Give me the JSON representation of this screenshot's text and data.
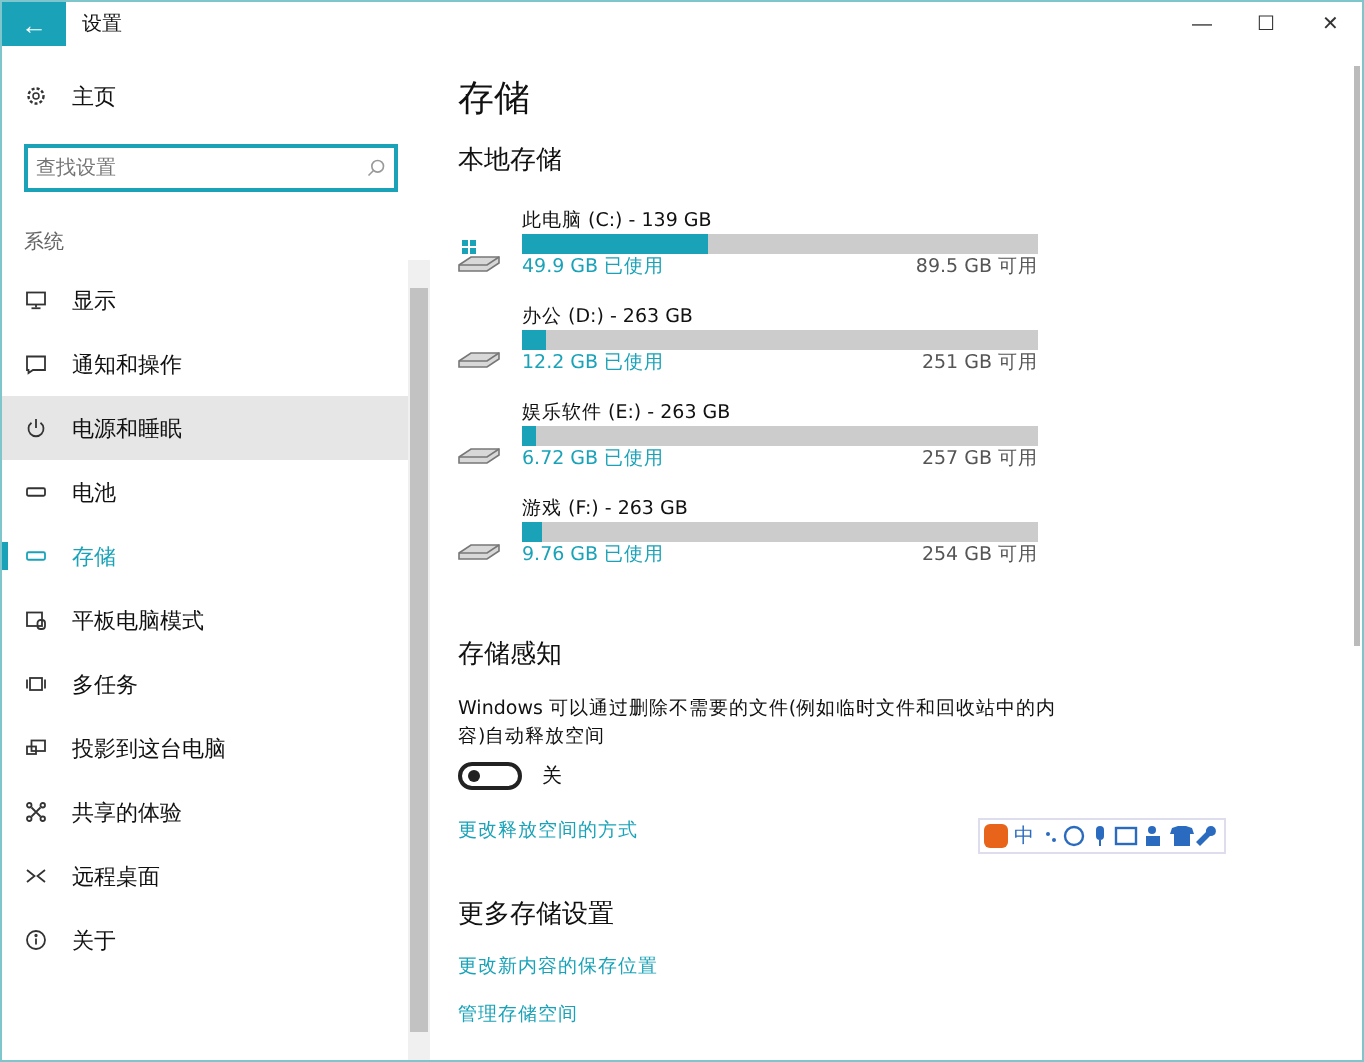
{
  "window": {
    "title": "设置",
    "back": "←",
    "controls": [
      "—",
      "☐",
      "✕"
    ]
  },
  "sidebar": {
    "home": "主页",
    "search": {
      "placeholder": "查找设置"
    },
    "section": "系统",
    "items": [
      {
        "label": "显示",
        "kind": "display",
        "selected": false,
        "hovered": false
      },
      {
        "label": "通知和操作",
        "kind": "notify",
        "selected": false,
        "hovered": false
      },
      {
        "label": "电源和睡眠",
        "kind": "power",
        "selected": false,
        "hovered": true
      },
      {
        "label": "电池",
        "kind": "battery",
        "selected": false,
        "hovered": false
      },
      {
        "label": "存储",
        "kind": "storage",
        "selected": true,
        "hovered": false
      },
      {
        "label": "平板电脑模式",
        "kind": "tablet",
        "selected": false,
        "hovered": false
      },
      {
        "label": "多任务",
        "kind": "multitask",
        "selected": false,
        "hovered": false
      },
      {
        "label": "投影到这台电脑",
        "kind": "project",
        "selected": false,
        "hovered": false
      },
      {
        "label": "共享的体验",
        "kind": "share",
        "selected": false,
        "hovered": false
      },
      {
        "label": "远程桌面",
        "kind": "remote",
        "selected": false,
        "hovered": false
      },
      {
        "label": "关于",
        "kind": "about",
        "selected": false,
        "hovered": false
      }
    ]
  },
  "main": {
    "title": "存储",
    "local_heading": "本地存储",
    "drives": [
      {
        "kind": "system",
        "name": "此电脑 (C:) - 139 GB",
        "level": 0.36,
        "used": "49.9 GB 已使用",
        "free": "89.5 GB 可用"
      },
      {
        "kind": "disk",
        "name": "办公 (D:) - 263 GB",
        "level": 0.046,
        "used": "12.2 GB 已使用",
        "free": "251 GB 可用"
      },
      {
        "kind": "disk",
        "name": "娱乐软件 (E:) - 263 GB",
        "level": 0.026,
        "used": "6.72 GB 已使用",
        "free": "257 GB 可用"
      },
      {
        "kind": "disk",
        "name": "游戏 (F:) - 263 GB",
        "level": 0.037,
        "used": "9.76 GB 已使用",
        "free": "254 GB 可用"
      }
    ],
    "sense_heading": "存储感知",
    "sense_text": "Windows 可以通过删除不需要的文件(例如临时文件和回收站中的内容)自动释放空间",
    "toggle": {
      "on": false,
      "label": "关"
    },
    "sense_link": "更改释放空间的方式",
    "more_heading": "更多存储设置",
    "more_links": [
      "更改新内容的保存位置",
      "管理存储空间"
    ]
  },
  "ime_toolbar": {
    "mode": "中"
  }
}
